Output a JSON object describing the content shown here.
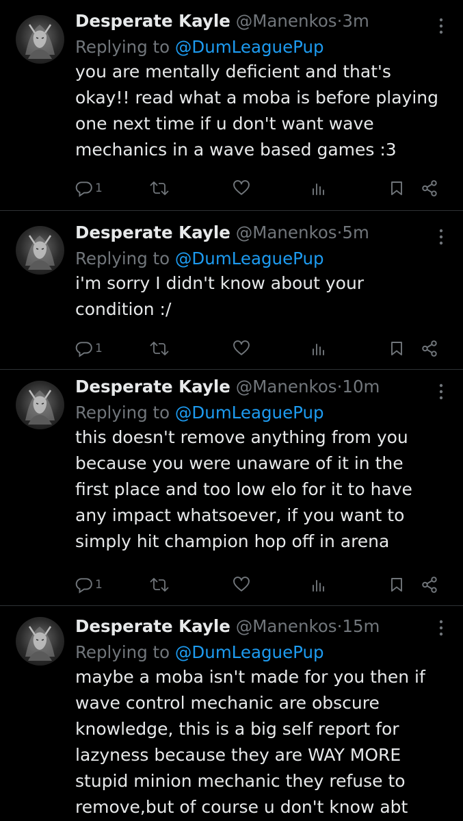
{
  "tweets": [
    {
      "name": "Desperate Kayle",
      "handle": "@Manenkos",
      "separator": "·",
      "time": "3m",
      "replying_label": "Replying to",
      "replying_to": "@DumLeaguePup",
      "text": "you are mentally deficient and that's\nokay!! read what a moba is before playing\none next time if u don't want wave\nmechanics in a wave based games :3",
      "reply_count": "1"
    },
    {
      "name": "Desperate Kayle",
      "handle": "@Manenkos",
      "separator": "·",
      "time": "5m",
      "replying_label": "Replying to",
      "replying_to": "@DumLeaguePup",
      "text": "i'm sorry I didn't know about your\ncondition :/",
      "reply_count": "1"
    },
    {
      "name": "Desperate Kayle",
      "handle": "@Manenkos",
      "separator": "·",
      "time": "10m",
      "replying_label": "Replying to",
      "replying_to": "@DumLeaguePup",
      "text": "this doesn't remove anything from you\nbecause you were unaware of it in the\nfirst place and too low elo for it to have\nany impact whatsoever, if you want to\nsimply hit champion hop off in arena",
      "reply_count": "1"
    },
    {
      "name": "Desperate Kayle",
      "handle": "@Manenkos",
      "separator": "·",
      "time": "15m",
      "replying_label": "Replying to",
      "replying_to": "@DumLeaguePup",
      "text": "maybe a moba isn't made for you then if\nwave control mechanic are obscure\nknowledge, this is a big self report for\nlazyness because they are WAY MORE\nstupid minion mechanic they refuse to\nremove,but of course u don't know abt",
      "reply_count": ""
    }
  ],
  "icons": {
    "reply": "reply-icon",
    "retweet": "retweet-icon",
    "like": "heart-icon",
    "views": "views-icon",
    "bookmark": "bookmark-icon",
    "share": "share-icon",
    "more": "more-vertical-icon"
  },
  "colors": {
    "background": "#000000",
    "text": "#e7e9ea",
    "muted": "#71767b",
    "link": "#1d9bf0",
    "divider": "#2f3336"
  }
}
